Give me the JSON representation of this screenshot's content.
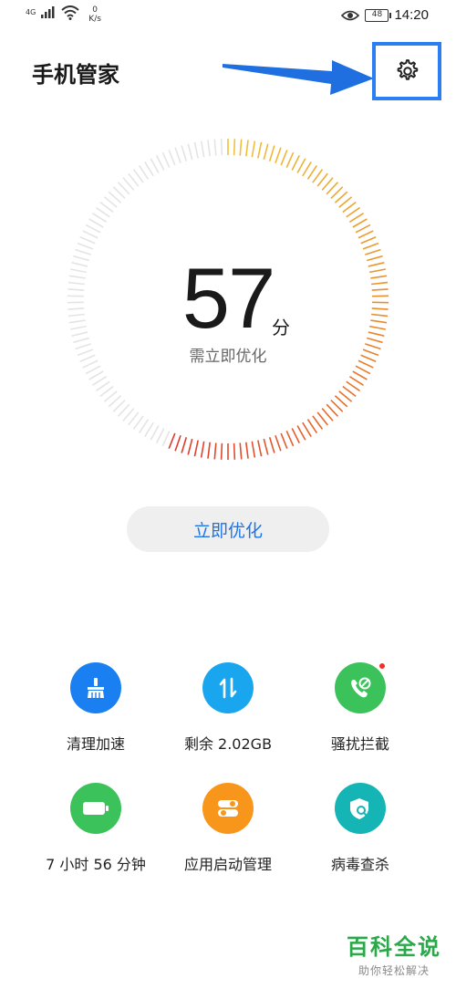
{
  "status_bar": {
    "network_type": "4G",
    "speed_value": "0",
    "speed_unit": "K/s",
    "battery": "48",
    "time": "14:20"
  },
  "header": {
    "title": "手机管家",
    "settings_icon": "gear-icon"
  },
  "score": {
    "value": "57",
    "unit": "分",
    "status": "需立即优化",
    "fraction": 0.57,
    "colors": {
      "low": "#e0382b",
      "mid": "#e9892c",
      "high": "#f0c23a",
      "track": "#e4e4e4"
    }
  },
  "optimize_button": {
    "label": "立即优化",
    "color": "#1e74e6"
  },
  "features": [
    {
      "label": "清理加速",
      "icon": "broom-icon",
      "color": "#1a7ff0"
    },
    {
      "label": "剩余 2.02GB",
      "icon": "data-transfer-icon",
      "color": "#1aa6ef"
    },
    {
      "label": "骚扰拦截",
      "icon": "phone-block-icon",
      "color": "#3cc25a",
      "badge": true
    },
    {
      "label": "7 小时 56 分钟",
      "icon": "battery-icon",
      "color": "#3cc25a"
    },
    {
      "label": "应用启动管理",
      "icon": "app-launch-icon",
      "color": "#f8961c"
    },
    {
      "label": "病毒查杀",
      "icon": "shield-search-icon",
      "color": "#15b5b5"
    }
  ],
  "watermark": {
    "title": "百科全说",
    "subtitle": "助你轻松解决"
  }
}
